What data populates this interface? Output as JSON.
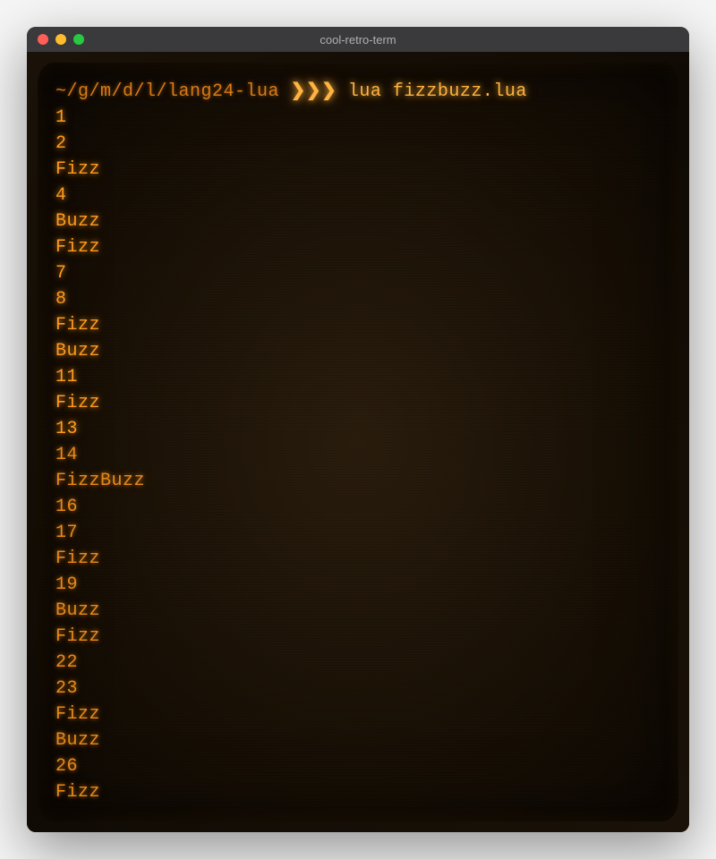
{
  "window": {
    "title": "cool-retro-term"
  },
  "terminal": {
    "prompt_path": "~/g/m/d/l/lang24-lua",
    "prompt_marker": "❯❯❯",
    "command": "lua fizzbuzz.lua",
    "output": [
      "1",
      "2",
      "Fizz",
      "4",
      "Buzz",
      "Fizz",
      "7",
      "8",
      "Fizz",
      "Buzz",
      "11",
      "Fizz",
      "13",
      "14",
      "FizzBuzz",
      "16",
      "17",
      "Fizz",
      "19",
      "Buzz",
      "Fizz",
      "22",
      "23",
      "Fizz",
      "Buzz",
      "26",
      "Fizz"
    ]
  }
}
